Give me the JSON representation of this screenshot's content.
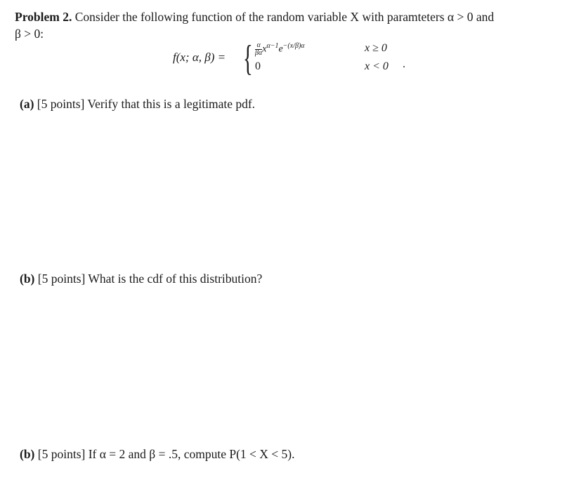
{
  "problem": {
    "heading": "Problem 2.",
    "intro_line1": "Consider the following function of the random variable X with paramteters α > 0 and",
    "intro_line2": "β > 0:"
  },
  "formula": {
    "lhs": "f(x; α, β) =",
    "case1_frac_num": "α",
    "case1_frac_den": "βα",
    "case1_expr_base": "x",
    "case1_expr_exp1": "α−1",
    "case1_expr_e": "e",
    "case1_expr_exp2": "−(x/β)α",
    "case1_condition": "x ≥ 0",
    "case2_value": "0",
    "case2_condition": "x < 0",
    "trailing": "."
  },
  "parts": [
    {
      "label": "(a)",
      "points": "[5 points]",
      "text": "Verify that this is a legitimate pdf."
    },
    {
      "label": "(b)",
      "points": "[5 points]",
      "text": "What is the cdf of this distribution?"
    },
    {
      "label": "(b)",
      "points": "[5 points]",
      "text": "If α = 2 and β = .5, compute P(1 < X < 5)."
    }
  ]
}
